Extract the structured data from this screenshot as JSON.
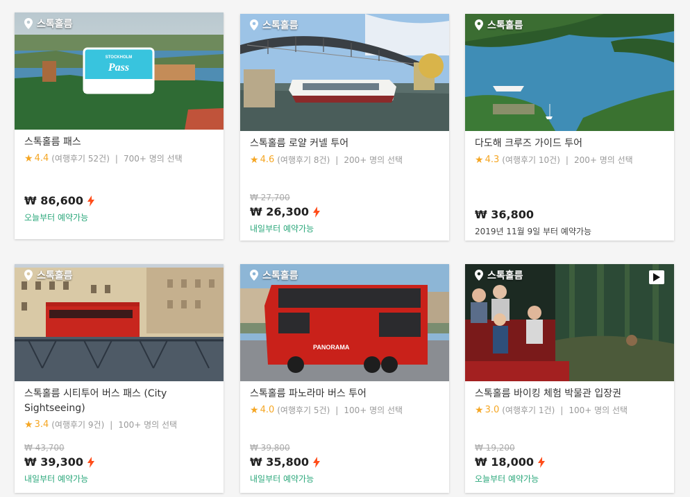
{
  "accent": "#2aa77a",
  "star_color": "#f5a623",
  "bolt_color": "#ff4d1a",
  "location": "스톡홀름",
  "stock_labels": {
    "reviews_fmt": "(여행후기 {n}건)",
    "sep": "|"
  },
  "products": [
    {
      "title": "스톡홀름 패스",
      "score": "4.4",
      "reviews": "(여행후기 52건)",
      "choices": "700+ 명의 선택",
      "original_price": "",
      "price": "₩ 86,600",
      "instant": true,
      "availability": "오늘부터 예약가능",
      "availability_style": "green",
      "thumb_text": "STOCKHOLM",
      "thumb_text2": "Pass",
      "video": false
    },
    {
      "title": "스톡홀름 로얄 커넬 투어",
      "score": "4.6",
      "reviews": "(여행후기 8건)",
      "choices": "200+ 명의 선택",
      "original_price": "₩ 27,700",
      "price": "₩ 26,300",
      "instant": true,
      "availability": "내일부터 예약가능",
      "availability_style": "green",
      "video": false
    },
    {
      "title": "다도해 크루즈 가이드 투어",
      "score": "4.3",
      "reviews": "(여행후기 10건)",
      "choices": "200+ 명의 선택",
      "original_price": "",
      "price": "₩ 36,800",
      "instant": false,
      "availability": "2019년 11월 9일 부터 예약가능",
      "availability_style": "dark",
      "video": false
    },
    {
      "title": "스톡홀름 시티투어 버스 패스 (City Sightseeing)",
      "score": "3.4",
      "reviews": "(여행후기 9건)",
      "choices": "100+ 명의 선택",
      "original_price": "₩ 43,700",
      "price": "₩ 39,300",
      "instant": true,
      "availability": "내일부터 예약가능",
      "availability_style": "green",
      "video": false
    },
    {
      "title": "스톡홀름 파노라마 버스 투어",
      "score": "4.0",
      "reviews": "(여행후기 5건)",
      "choices": "100+ 명의 선택",
      "original_price": "₩ 39,800",
      "price": "₩ 35,800",
      "instant": true,
      "availability": "내일부터 예약가능",
      "availability_style": "green",
      "thumb_text": "PANORAMA",
      "video": false
    },
    {
      "title": "스톡홀름 바이킹 체험 박물관 입장권",
      "score": "3.0",
      "reviews": "(여행후기 1건)",
      "choices": "100+ 명의 선택",
      "original_price": "₩ 19,200",
      "price": "₩ 18,000",
      "instant": true,
      "availability": "오늘부터 예약가능",
      "availability_style": "green",
      "video": true
    }
  ]
}
